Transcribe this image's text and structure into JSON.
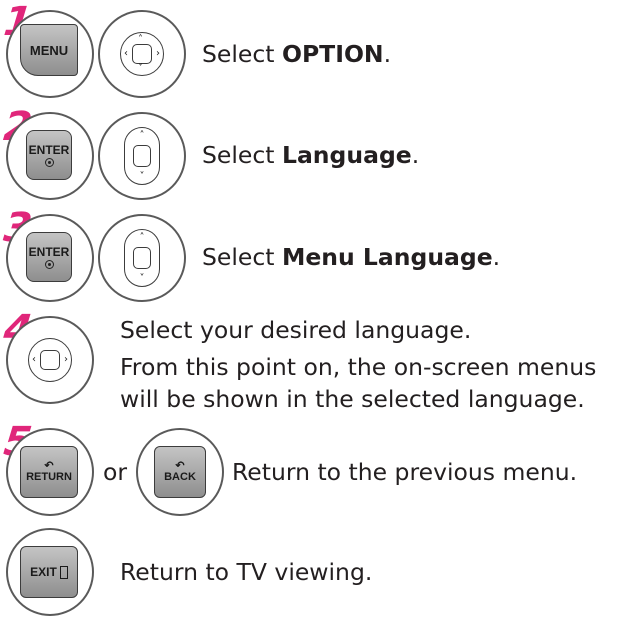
{
  "steps": [
    {
      "num": "1",
      "button": "MENU",
      "pad": "four-way",
      "text_prefix": "Select ",
      "text_bold": "OPTION",
      "text_suffix": "."
    },
    {
      "num": "2",
      "button": "ENTER",
      "pad": "up-down",
      "text_prefix": "Select ",
      "text_bold": "Language",
      "text_suffix": "."
    },
    {
      "num": "3",
      "button": "ENTER",
      "pad": "up-down",
      "text_prefix": "Select ",
      "text_bold": "Menu Language",
      "text_suffix": "."
    },
    {
      "num": "4",
      "pad": "left-right",
      "line1": "Select your desired language.",
      "line2": "From this point on, the on-screen menus",
      "line3": "will be shown in the selected language."
    },
    {
      "num": "5",
      "button_a": "RETURN",
      "or_label": "or",
      "button_b": "BACK",
      "text": "Return to the previous menu."
    },
    {
      "button": "EXIT",
      "text": "Return to TV viewing."
    }
  ],
  "colors": {
    "step_number": "#e0267a",
    "button_fill": "#a8a8a8",
    "outline": "#3c3c3c"
  },
  "icons": [
    "enter-dot-icon",
    "return-arrow-icon",
    "exit-door-icon",
    "nav-arrow-icon"
  ]
}
